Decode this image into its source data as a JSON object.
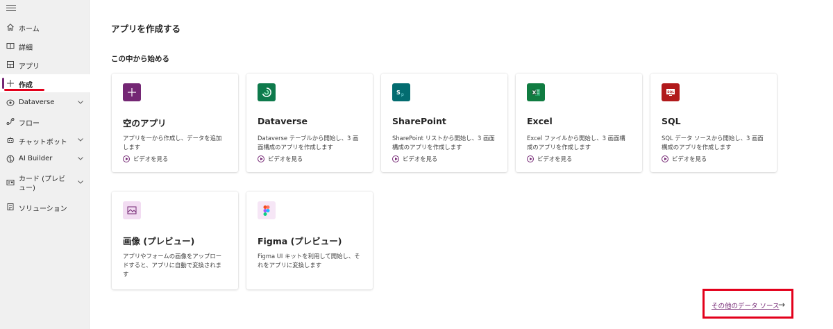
{
  "sidebar": {
    "items": [
      {
        "label": "ホーム",
        "icon": "home-icon"
      },
      {
        "label": "詳細",
        "icon": "book-icon"
      },
      {
        "label": "アプリ",
        "icon": "apps-icon"
      },
      {
        "label": "作成",
        "icon": "plus-icon",
        "active": true
      },
      {
        "label": "Dataverse",
        "icon": "dataverse-icon",
        "expandable": true
      },
      {
        "label": "フロー",
        "icon": "flow-icon"
      },
      {
        "label": "チャットボット",
        "icon": "bot-icon",
        "expandable": true
      },
      {
        "label": "AI Builder",
        "icon": "ai-builder-icon",
        "expandable": true
      },
      {
        "label": "カード (プレビュー)",
        "icon": "card-icon",
        "expandable": true
      },
      {
        "label": "ソリューション",
        "icon": "solution-icon"
      }
    ]
  },
  "main": {
    "page_title": "アプリを作成する",
    "section_title": "この中から始める",
    "video_label": "ビデオを見る",
    "cards": [
      {
        "title": "空のアプリ",
        "desc": "アプリを一から作成し、データを追加します",
        "icon": "plus-icon",
        "color": "#742774",
        "has_video": true
      },
      {
        "title": "Dataverse",
        "desc": "Dataverse テーブルから開始し、3 画面構成のアプリを作成します",
        "icon": "dataverse-icon",
        "color": "#0e7a4c",
        "has_video": true
      },
      {
        "title": "SharePoint",
        "desc": "SharePoint リストから開始し、3 画面構成のアプリを作成します",
        "icon": "sharepoint-icon",
        "color": "#036c70",
        "has_video": true
      },
      {
        "title": "Excel",
        "desc": "Excel ファイルから開始し、3 画面構成のアプリを作成します",
        "icon": "excel-icon",
        "color": "#107c41",
        "has_video": true
      },
      {
        "title": "SQL",
        "desc": "SQL データ ソースから開始し、3 画面構成のアプリを作成します",
        "icon": "sql-icon",
        "color": "#b1191b",
        "has_video": true
      },
      {
        "title": "画像 (プレビュー)",
        "desc": "アプリやフォームの画像をアップロードすると、アプリに自動で変換されます",
        "icon": "image-icon",
        "color": "#f2dcf2",
        "has_video": false
      },
      {
        "title": "Figma (プレビュー)",
        "desc": "Figma UI キットを利用して開始し、それをアプリに変換します",
        "icon": "figma-icon",
        "color": "#f6e6f6",
        "has_video": false
      }
    ],
    "more_link": "その他のデータ ソース"
  },
  "colors": {
    "accent": "#742774",
    "highlight": "#e3001b"
  }
}
